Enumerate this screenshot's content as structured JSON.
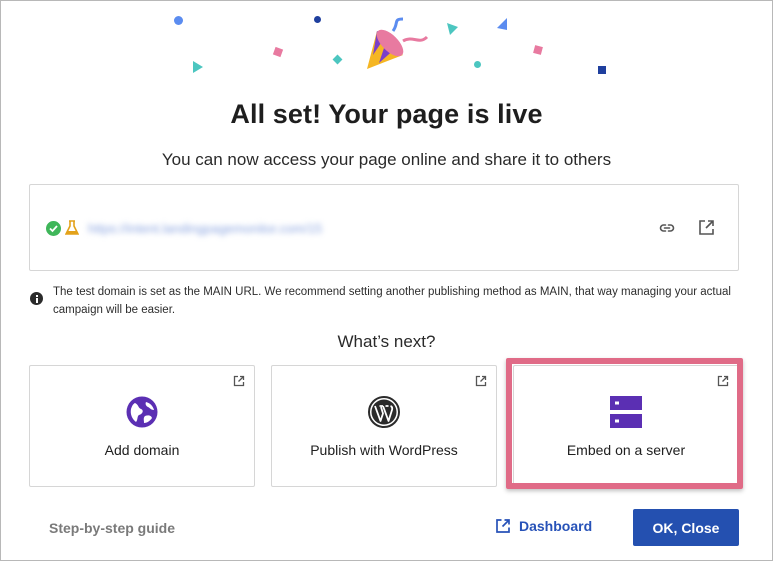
{
  "header": {
    "title": "All set! Your page is live",
    "subtitle": "You can now access your page online and share it to others"
  },
  "url_box": {
    "url": "https://intent.landingpagemonitor.com/15",
    "status_icon": "check-circle-icon",
    "test_icon": "flask-icon",
    "actions": [
      "link-icon",
      "external-link-icon"
    ]
  },
  "info": {
    "icon": "info-icon",
    "text": "The test domain is set as the MAIN URL. We recommend setting another publishing method as MAIN, that way managing your actual campaign will be easier."
  },
  "next": {
    "heading": "What’s next?",
    "cards": [
      {
        "label": "Add domain",
        "icon": "globe-icon",
        "color": "#5b2fb3"
      },
      {
        "label": "Publish with WordPress",
        "icon": "wordpress-icon",
        "color": "#2b2b2b"
      },
      {
        "label": "Embed on a server",
        "icon": "server-icon",
        "color": "#5b2fb3"
      }
    ]
  },
  "footer": {
    "guide_label": "Step-by-step guide",
    "dashboard_label": "Dashboard",
    "ok_label": "OK, Close"
  },
  "colors": {
    "primary": "#2450b0",
    "accent_purple": "#5b2fb3",
    "highlight": "#e06b87",
    "success": "#3fb65a"
  }
}
